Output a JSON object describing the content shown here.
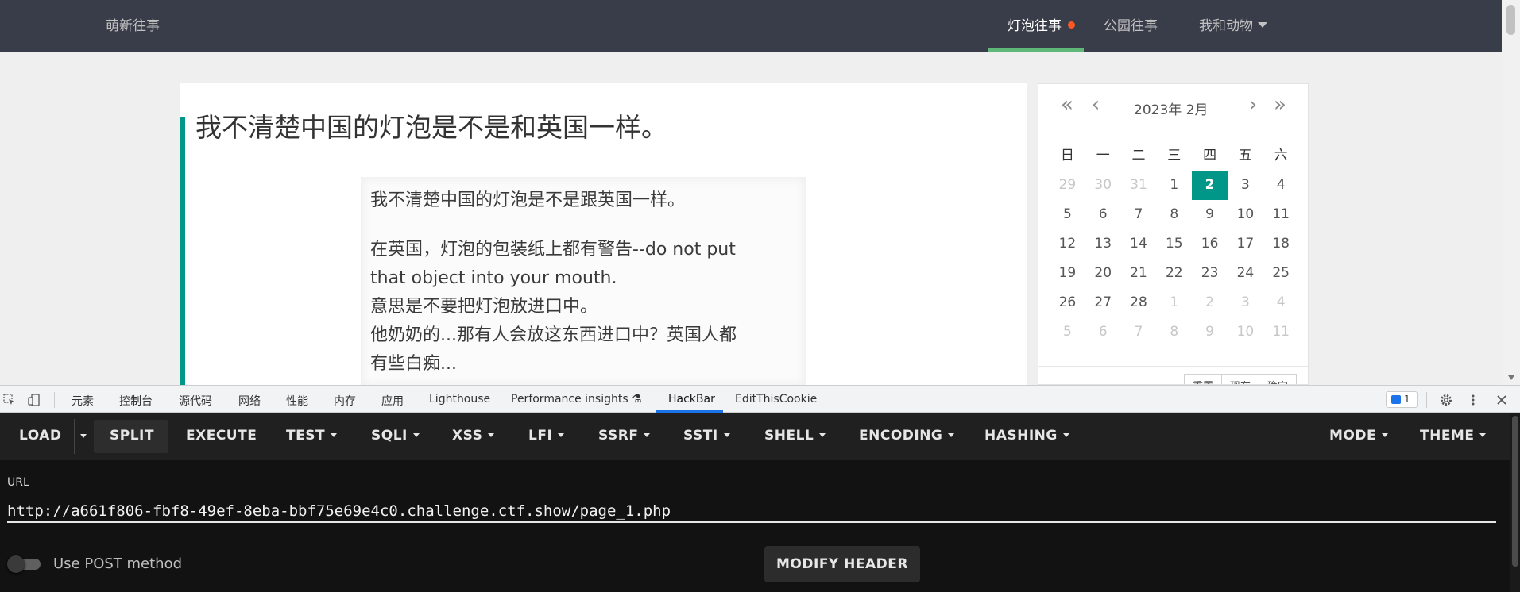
{
  "site": {
    "brand": "萌新往事",
    "nav": [
      {
        "label": "灯泡往事",
        "active": true
      },
      {
        "label": "公园往事"
      },
      {
        "label": "我和动物"
      }
    ]
  },
  "article": {
    "title": "我不清楚中国的灯泡是不是和英国一样。",
    "image_lines": [
      "我不清楚中国的灯泡是不是跟英国一样。",
      "在英国，灯泡的包装纸上都有警告--do not put",
      "that object into your mouth.",
      "意思是不要把灯泡放进口中。",
      "他奶奶的...那有人会放这东西进口中？英国人都",
      "有些白痴..."
    ]
  },
  "calendar": {
    "year_month": "2023年  2月",
    "weekdays": [
      "日",
      "一",
      "二",
      "三",
      "四",
      "五",
      "六"
    ],
    "weeks": [
      [
        "29",
        "30",
        "31",
        "1",
        "2",
        "3",
        "4"
      ],
      [
        "5",
        "6",
        "7",
        "8",
        "9",
        "10",
        "11"
      ],
      [
        "12",
        "13",
        "14",
        "15",
        "16",
        "17",
        "18"
      ],
      [
        "19",
        "20",
        "21",
        "22",
        "23",
        "24",
        "25"
      ],
      [
        "26",
        "27",
        "28",
        "1",
        "2",
        "3",
        "4"
      ],
      [
        "5",
        "6",
        "7",
        "8",
        "9",
        "10",
        "11"
      ]
    ],
    "buttons": {
      "reset": "重置",
      "now": "现在",
      "confirm": "确定"
    }
  },
  "devtools": {
    "tabs": [
      "元素",
      "控制台",
      "源代码",
      "网络",
      "性能",
      "内存",
      "应用",
      "Lighthouse",
      "Performance insights",
      "HackBar",
      "EditThisCookie"
    ],
    "active_tab": "HackBar",
    "issues_count": "1"
  },
  "hackbar": {
    "buttons": {
      "load": "LOAD",
      "split": "SPLIT",
      "execute": "EXECUTE",
      "test": "TEST",
      "sqli": "SQLI",
      "xss": "XSS",
      "lfi": "LFI",
      "ssrf": "SSRF",
      "ssti": "SSTI",
      "shell": "SHELL",
      "encoding": "ENCODING",
      "hashing": "HASHING",
      "mode": "MODE",
      "theme": "THEME"
    },
    "url_label": "URL",
    "url_value": "http://a661f806-fbf8-49ef-8eba-bbf75e69e4c0.challenge.ctf.show/page_1.php",
    "post_label": "Use POST method",
    "modify_header": "MODIFY HEADER"
  }
}
